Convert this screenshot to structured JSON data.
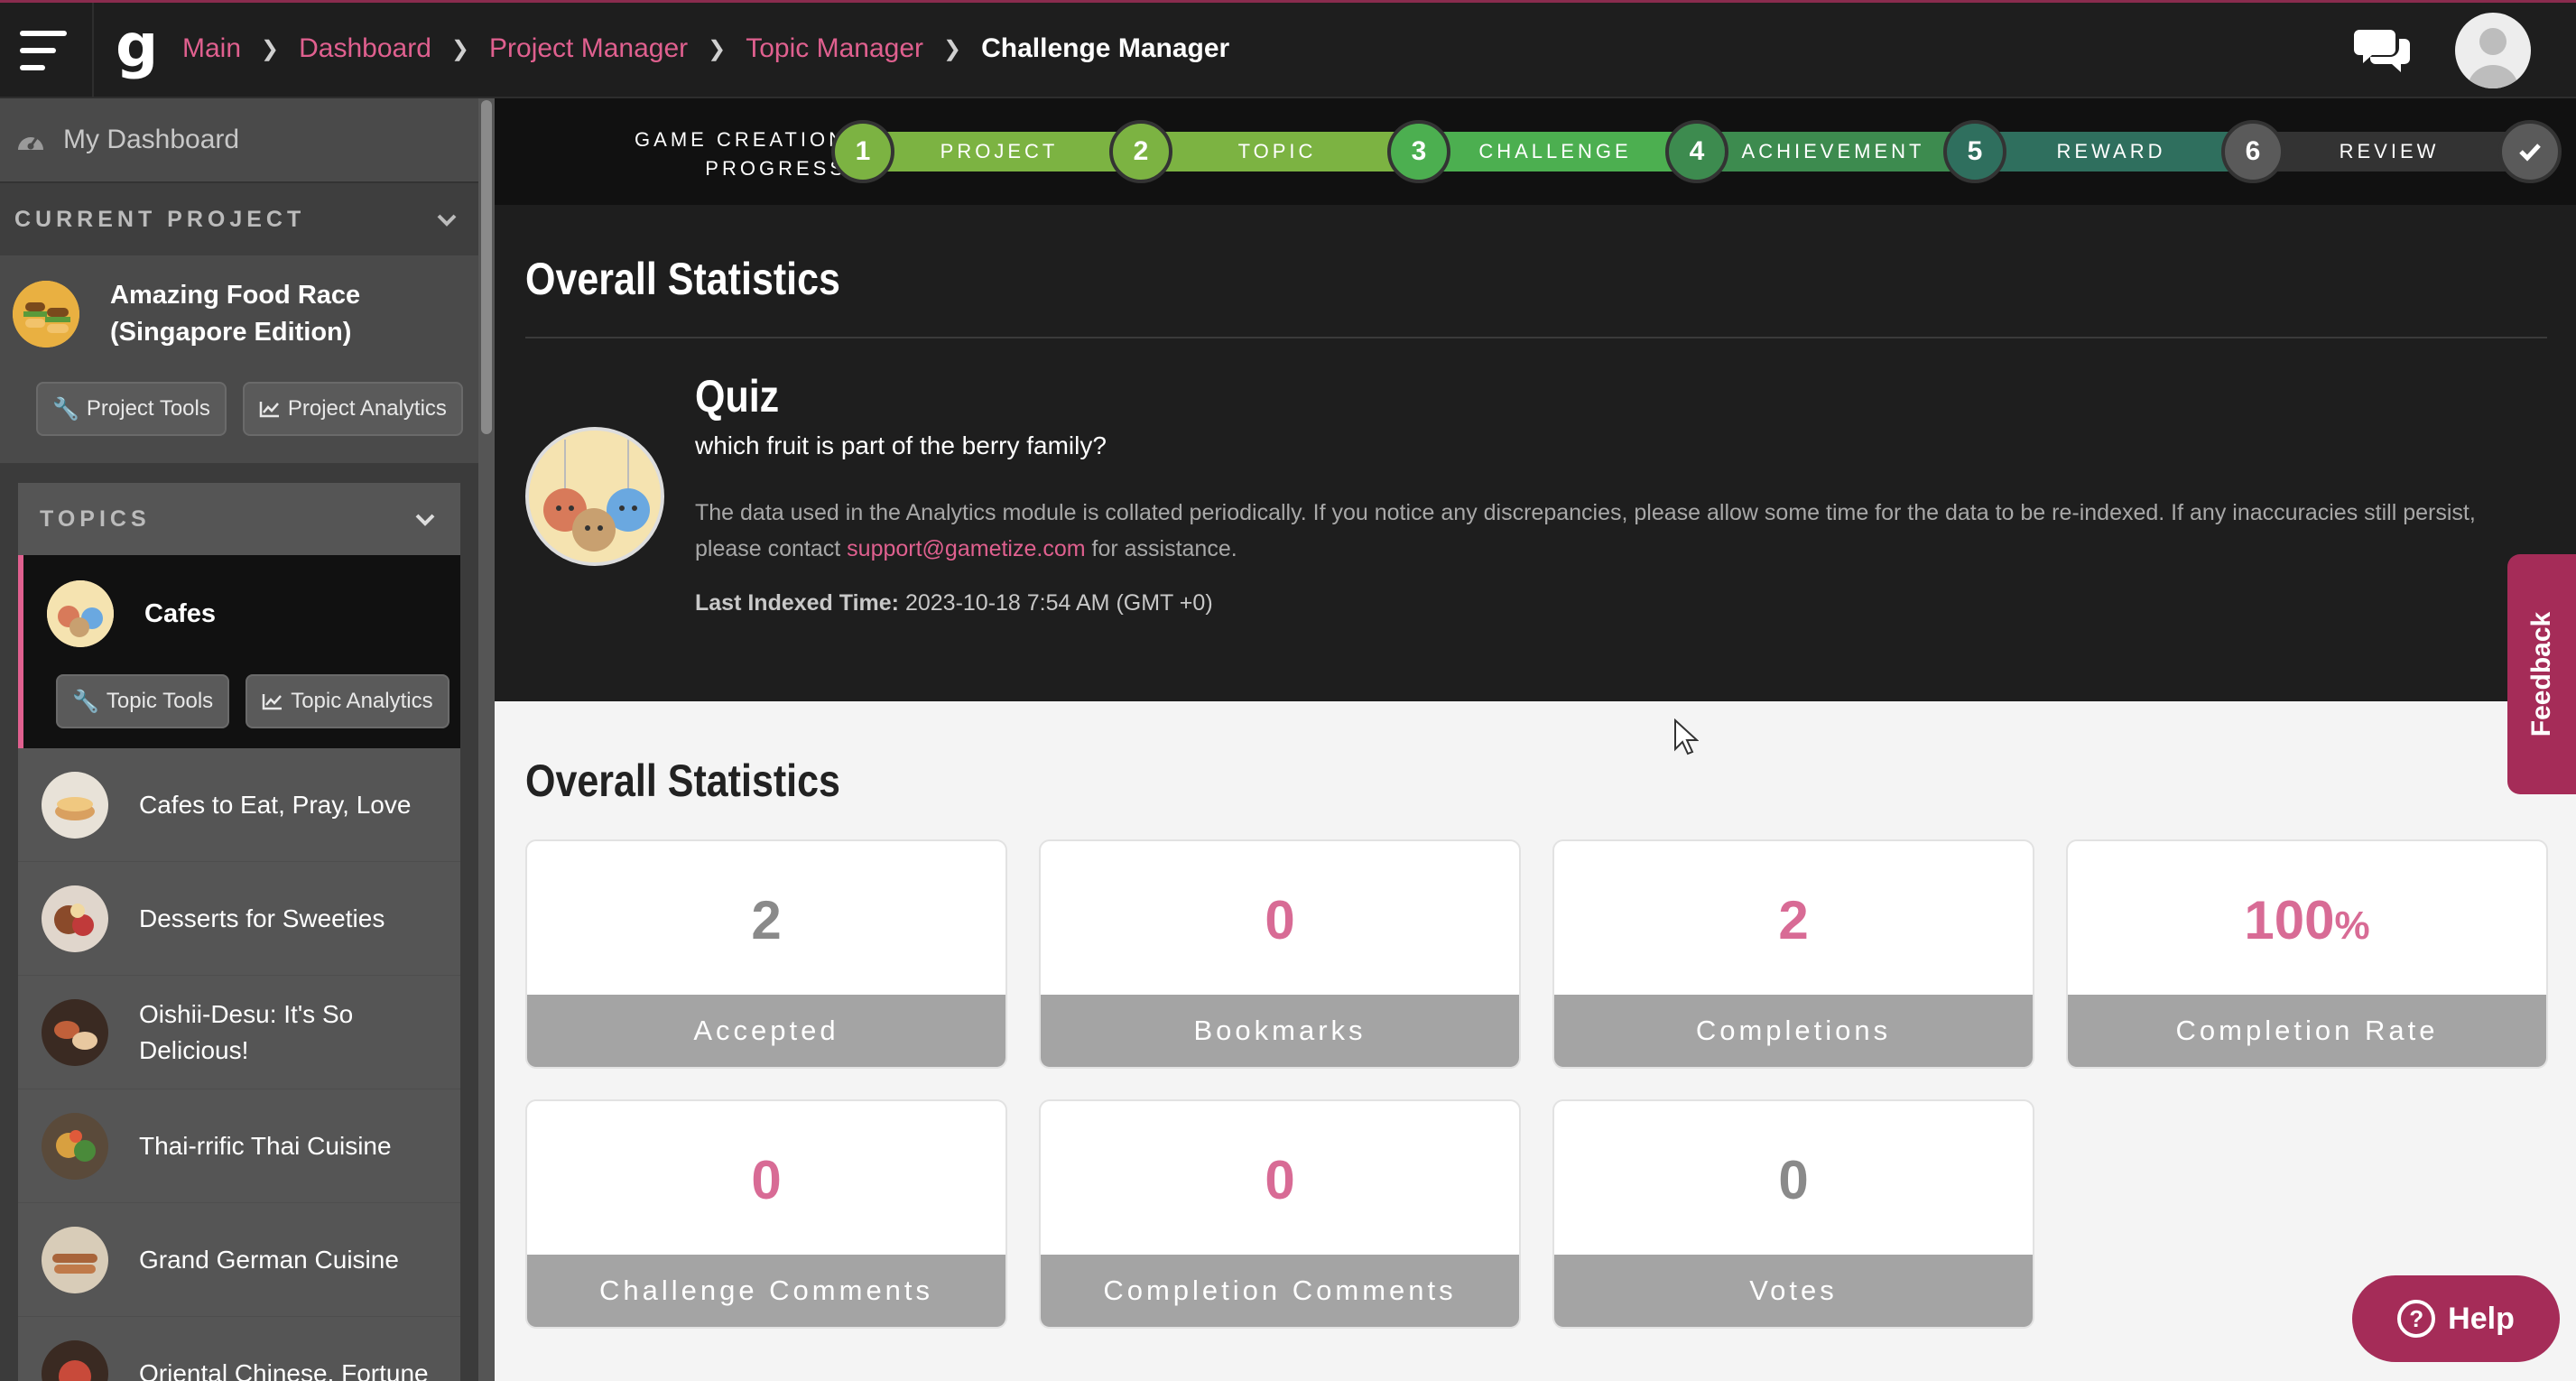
{
  "header": {
    "breadcrumbs": [
      "Main",
      "Dashboard",
      "Project Manager",
      "Topic Manager"
    ],
    "current_page": "Challenge Manager",
    "logo_letter": "g"
  },
  "sidebar": {
    "dashboard_label": "My Dashboard",
    "current_project_heading": "CURRENT PROJECT",
    "project_name": "Amazing Food Race (Singapore Edition)",
    "project_tools_label": "Project Tools",
    "project_analytics_label": "Project Analytics",
    "topics_heading": "TOPICS",
    "active_topic": {
      "name": "Cafes",
      "tools_label": "Topic Tools",
      "analytics_label": "Topic Analytics"
    },
    "topics": [
      {
        "name": "Cafes to Eat, Pray, Love"
      },
      {
        "name": "Desserts for Sweeties"
      },
      {
        "name": "Oishii-Desu: It's So Delicious!"
      },
      {
        "name": "Thai-rrific Thai Cuisine"
      },
      {
        "name": "Grand German Cuisine"
      },
      {
        "name": "Oriental Chinese, Fortune"
      }
    ]
  },
  "progress": {
    "title_line1": "GAME CREATION",
    "title_line2": "PROGRESS",
    "steps": [
      {
        "num": "1",
        "label": "PROJECT",
        "color": "#7cb342"
      },
      {
        "num": "2",
        "label": "TOPIC",
        "color": "#7cb342"
      },
      {
        "num": "3",
        "label": "CHALLENGE",
        "color": "#4caf50"
      },
      {
        "num": "4",
        "label": "ACHIEVEMENT",
        "color": "#3d8b4f"
      },
      {
        "num": "5",
        "label": "REWARD",
        "color": "#2f6f5e"
      },
      {
        "num": "6",
        "label": "REVIEW",
        "color": "#5a5a5a"
      }
    ]
  },
  "overview": {
    "section_title": "Overall Statistics",
    "challenge_type": "Quiz",
    "challenge_question": "which fruit is part of the berry family?",
    "note_text": "The data used in the Analytics module is collated periodically. If you notice any discrepancies, please allow some time for the data to be re-indexed. If any inaccuracies still persist, please contact ",
    "support_email": "support@gametize.com",
    "note_suffix": " for assistance.",
    "indexed_label": "Last Indexed Time:",
    "indexed_value": "2023-10-18 7:54 AM (GMT +0)"
  },
  "stats": {
    "section_title": "Overall Statistics",
    "cards": [
      {
        "value": "2",
        "label": "Accepted",
        "color": "#8a8a8a"
      },
      {
        "value": "0",
        "label": "Bookmarks",
        "color": "#d86b95"
      },
      {
        "value": "2",
        "label": "Completions",
        "color": "#d86b95"
      },
      {
        "value": "100",
        "suffix": "%",
        "label": "Completion Rate",
        "color": "#d86b95"
      },
      {
        "value": "0",
        "label": "Challenge Comments",
        "color": "#d86b95"
      },
      {
        "value": "0",
        "label": "Completion Comments",
        "color": "#d86b95"
      },
      {
        "value": "0",
        "label": "Votes",
        "color": "#8a8a8a"
      }
    ]
  },
  "floating": {
    "feedback_label": "Feedback",
    "help_label": "Help"
  },
  "colors": {
    "accent": "#e0608f",
    "brand": "#a52c58"
  }
}
